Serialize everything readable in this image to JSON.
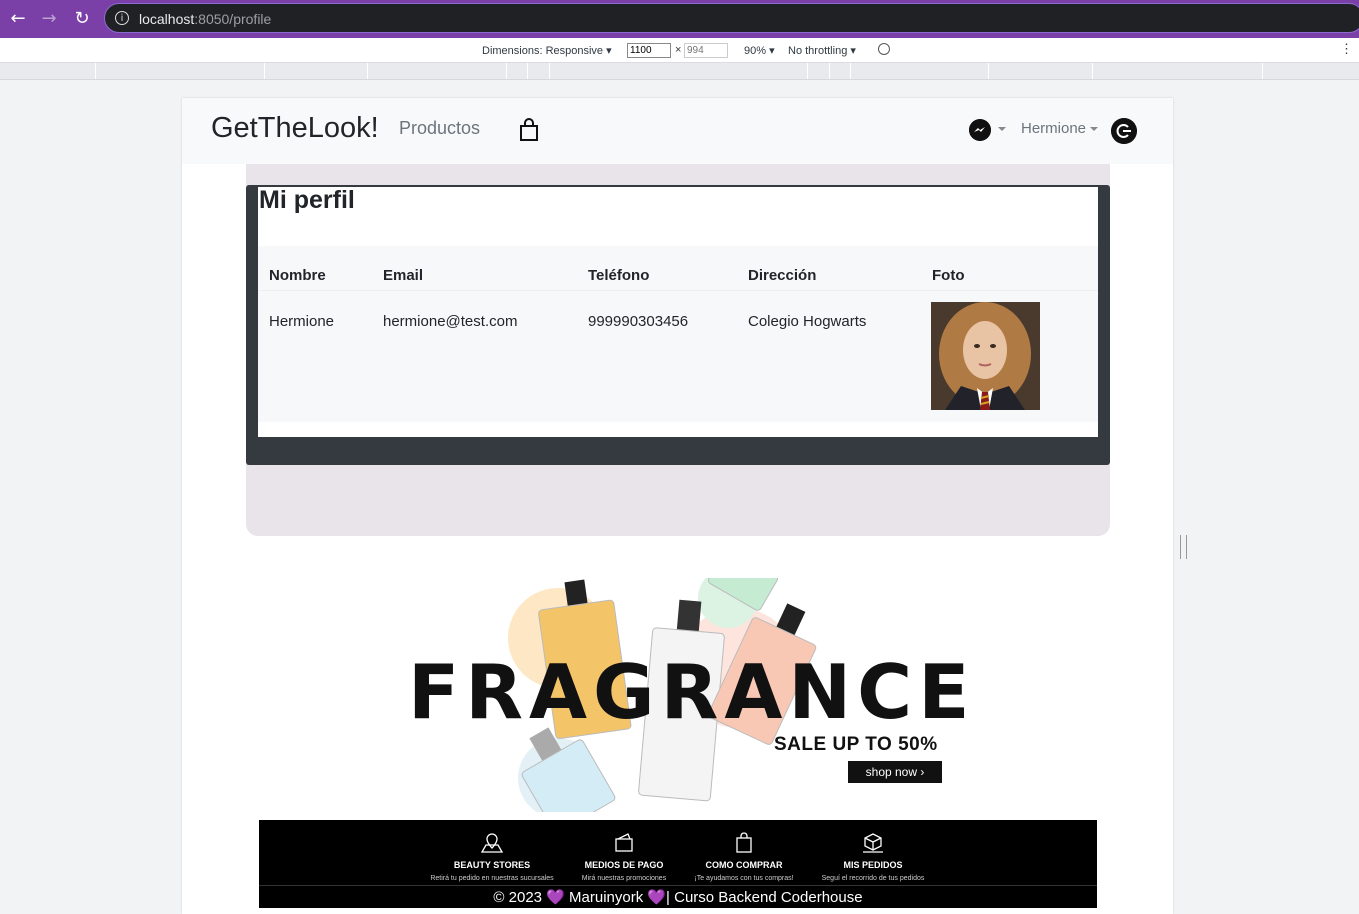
{
  "browser": {
    "url_host": "localhost",
    "url_rest": ":8050/profile"
  },
  "devtools": {
    "dimensions_label": "Dimensions: Responsive ▾",
    "width_value": "1100",
    "height_placeholder": "994",
    "times": "×",
    "zoom": "90% ▾",
    "throttling": "No throttling ▾"
  },
  "navbar": {
    "brand": "GetTheLook!",
    "products_link": "Productos",
    "user_name": "Hermione"
  },
  "profile": {
    "title": "Mi perfil",
    "columns": [
      "Nombre",
      "Email",
      "Teléfono",
      "Dirección",
      "Foto"
    ],
    "row": {
      "nombre": "Hermione",
      "email": "hermione@test.com",
      "telefono": "999990303456",
      "direccion": "Colegio Hogwarts"
    }
  },
  "banner": {
    "headline": "FRAGRANCE",
    "sale": "SALE UP TO 50%",
    "cta": "shop now ›"
  },
  "footer": {
    "features": [
      {
        "title": "BEAUTY STORES",
        "subtitle": "Retirá tu pedido en nuestras sucursales",
        "icon": "map-pin-icon"
      },
      {
        "title": "MEDIOS DE PAGO",
        "subtitle": "Mirá nuestras promociones",
        "icon": "wallet-icon"
      },
      {
        "title": "COMO COMPRAR",
        "subtitle": "¡Te ayudamos con tus compras!",
        "icon": "shopping-bag-icon"
      },
      {
        "title": "MIS PEDIDOS",
        "subtitle": "Seguí el recorrido de tus pedidos",
        "icon": "package-icon"
      }
    ],
    "copyright": "© 2023 💜 Maruinyork 💜| Curso Backend Coderhouse"
  },
  "colors": {
    "chrome_purple": "#7b3fa8",
    "panel_lilac": "#e9e3ea",
    "panel_dark": "#343a40",
    "footer_black": "#000000"
  }
}
